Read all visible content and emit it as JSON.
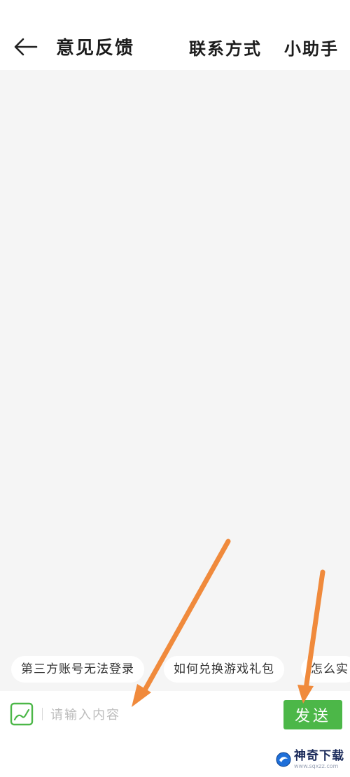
{
  "header": {
    "title": "意见反馈",
    "contact_label": "联系方式",
    "helper_label": "小助手"
  },
  "quick_questions": [
    {
      "label": "第三方账号无法登录"
    },
    {
      "label": "如何兑换游戏礼包"
    },
    {
      "label": "怎么实"
    }
  ],
  "composer": {
    "placeholder": "请输入内容",
    "value": "",
    "send_label": "发送"
  },
  "watermark": {
    "title": "神奇下载",
    "url": "www.sqxzz.com"
  },
  "colors": {
    "accent": "#4cb748",
    "chat_bg": "#f5f5f5",
    "annotation_arrow": "#f08a3c"
  },
  "icons": {
    "back": "arrow-left-icon",
    "image": "image-icon"
  }
}
